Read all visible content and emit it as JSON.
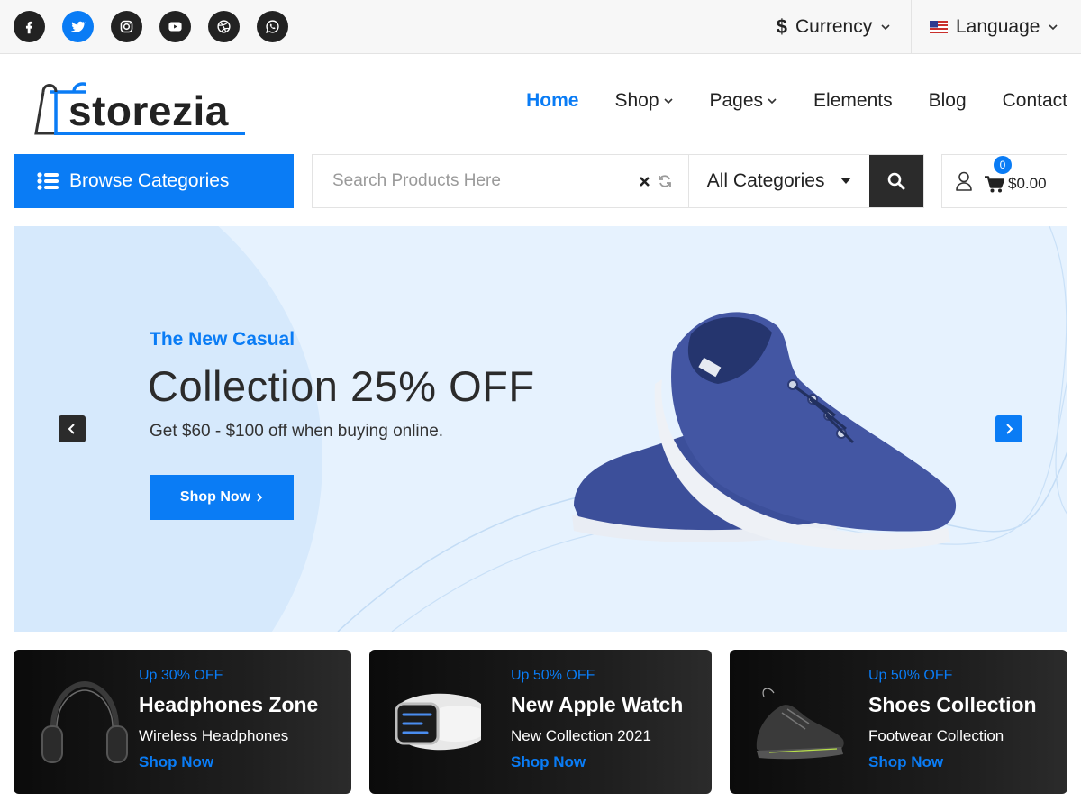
{
  "topbar": {
    "social": [
      "facebook-icon",
      "twitter-icon",
      "instagram-icon",
      "youtube-icon",
      "dribbble-icon",
      "whatsapp-icon"
    ],
    "currency_label": "Currency",
    "language_label": "Language"
  },
  "brand": {
    "name": "storezia"
  },
  "nav": {
    "items": [
      {
        "label": "Home"
      },
      {
        "label": "Shop"
      },
      {
        "label": "Pages"
      },
      {
        "label": "Elements"
      },
      {
        "label": "Blog"
      },
      {
        "label": "Contact"
      }
    ]
  },
  "search": {
    "browse_label": "Browse Categories",
    "placeholder": "Search Products Here",
    "category_selected": "All Categories"
  },
  "cart": {
    "count": "0",
    "total": "$0.00"
  },
  "hero": {
    "eyebrow": "The New Casual",
    "title": "Collection 25% OFF",
    "subtitle": "Get $60 - $100 off when buying online.",
    "button_label": "Shop Now"
  },
  "promos": [
    {
      "eyebrow": "Up 30% OFF",
      "title": "Headphones Zone",
      "subtitle": "Wireless Headphones",
      "link": "Shop Now"
    },
    {
      "eyebrow": "Up 50% OFF",
      "title": "New Apple Watch",
      "subtitle": "New Collection 2021",
      "link": "Shop Now"
    },
    {
      "eyebrow": "Up 50% OFF",
      "title": "Shoes Collection",
      "subtitle": "Footwear Collection",
      "link": "Shop Now"
    }
  ],
  "colors": {
    "accent": "#0a7cf5",
    "dark": "#2b2b2b",
    "hero_bg": "#e6f2fe"
  }
}
